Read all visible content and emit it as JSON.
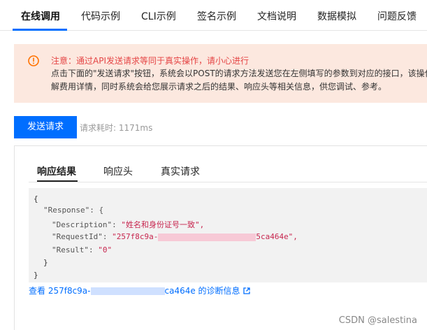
{
  "top_tabs": [
    {
      "label": "在线调用",
      "active": true
    },
    {
      "label": "代码示例",
      "active": false
    },
    {
      "label": "CLI示例",
      "active": false
    },
    {
      "label": "签名示例",
      "active": false
    },
    {
      "label": "文档说明",
      "active": false
    },
    {
      "label": "数据模拟",
      "active": false
    },
    {
      "label": "问题反馈",
      "active": false
    }
  ],
  "warning": {
    "icon": "alert-circle-icon",
    "title": "注意：通过API发送请求等同于真实操作，请小心进行",
    "line1": "点击下面的\"发送请求\"按钮，系统会以POST的请求方法发送您在左侧填写的参数到对应的接口，该操作",
    "line2": "解费用详情，同时系统会给您展示请求之后的结果、响应头等相关信息，供您调试、参考。"
  },
  "send": {
    "button_label": "发送请求",
    "time_text": "请求耗时: 1171ms"
  },
  "result_tabs": [
    {
      "label": "响应结果",
      "active": true
    },
    {
      "label": "响应头",
      "active": false
    },
    {
      "label": "真实请求",
      "active": false
    }
  ],
  "response_json": {
    "open_brace": "{",
    "response_key": "\"Response\": {",
    "description_key": "\"Description\": ",
    "description_value": "\"姓名和身份证号一致\",",
    "request_id_key": "\"RequestId\": ",
    "request_id_prefix": "\"257f8c9a-",
    "request_id_suffix": "5ca464e\",",
    "result_key": "\"Result\": ",
    "result_value": "\"0\"",
    "inner_close": "}",
    "outer_close": "}"
  },
  "diagnostic": {
    "prefix": "查看 257f8c9a-",
    "suffix": "ca464e 的诊断信息",
    "icon": "external-link-icon"
  },
  "watermark": "CSDN @salestina",
  "colors": {
    "accent": "#006eff",
    "warning_bg": "#fce8df",
    "warning_title": "#e54545",
    "string_value": "#c7254e"
  }
}
